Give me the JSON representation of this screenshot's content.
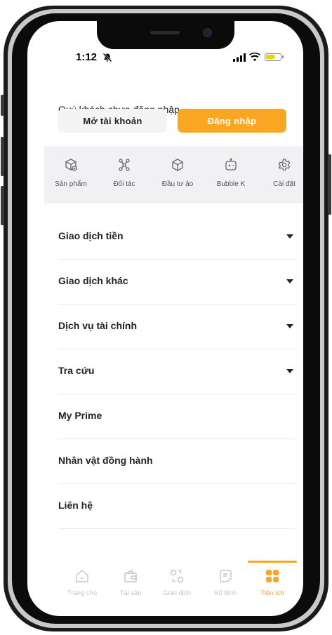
{
  "status_bar": {
    "time": "1:12"
  },
  "login": {
    "note": "Quý khách chưa đăng nhập.",
    "open_account_label": "Mở tài khoản",
    "login_label": "Đăng nhập"
  },
  "quick_menu": [
    {
      "label": "Sản phẩm",
      "icon": "box-check-icon"
    },
    {
      "label": "Đối tác",
      "icon": "network-nodes-icon"
    },
    {
      "label": "Đầu tư ảo",
      "icon": "cube-icon"
    },
    {
      "label": "Bubble K",
      "icon": "robot-icon"
    },
    {
      "label": "Cài đặt",
      "icon": "gear-icon"
    }
  ],
  "menu": [
    {
      "label": "Giao dịch tiền",
      "expandable": true
    },
    {
      "label": "Giao dịch khác",
      "expandable": true
    },
    {
      "label": "Dịch vụ tài chính",
      "expandable": true
    },
    {
      "label": "Tra cứu",
      "expandable": true
    },
    {
      "label": "My Prime",
      "expandable": false
    },
    {
      "label": "Nhân vật đồng hành",
      "expandable": false
    },
    {
      "label": "Liên hệ",
      "expandable": false
    }
  ],
  "tabbar": {
    "active_index": 4,
    "items": [
      {
        "label": "Trang chủ",
        "icon": "home-icon"
      },
      {
        "label": "Tài sản",
        "icon": "wallet-icon"
      },
      {
        "label": "Giao dịch",
        "icon": "trade-icon"
      },
      {
        "label": "Sổ lệnh",
        "icon": "order-book-icon"
      },
      {
        "label": "Tiện ích",
        "icon": "grid-icon"
      }
    ]
  },
  "colors": {
    "accent": "#f9a623",
    "quick_bg": "#f1f1f3",
    "inactive": "#c4c4c4"
  }
}
